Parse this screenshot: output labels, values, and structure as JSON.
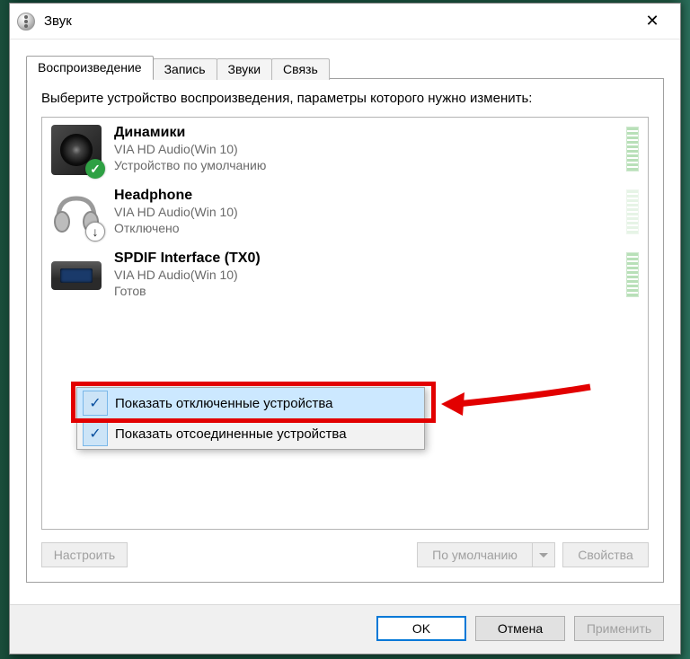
{
  "window_title": "Звук",
  "tabs": [
    "Воспроизведение",
    "Запись",
    "Звуки",
    "Связь"
  ],
  "active_tab_index": 0,
  "instruction": "Выберите устройство воспроизведения, параметры которого нужно изменить:",
  "devices": [
    {
      "name": "Динамики",
      "driver": "VIA HD Audio(Win 10)",
      "status": "Устройство по умолчанию"
    },
    {
      "name": "Headphone",
      "driver": "VIA HD Audio(Win 10)",
      "status": "Отключено"
    },
    {
      "name": "SPDIF Interface (TX0)",
      "driver": "VIA HD Audio(Win 10)",
      "status": "Готов"
    }
  ],
  "context_menu": {
    "items": [
      {
        "label": "Показать отключенные устройства",
        "checked": true,
        "highlighted": true
      },
      {
        "label": "Показать отсоединенные устройства",
        "checked": true,
        "highlighted": false
      }
    ]
  },
  "buttons": {
    "configure": "Настроить",
    "default": "По умолчанию",
    "properties": "Свойства",
    "ok": "OK",
    "cancel": "Отмена",
    "apply": "Применить"
  }
}
